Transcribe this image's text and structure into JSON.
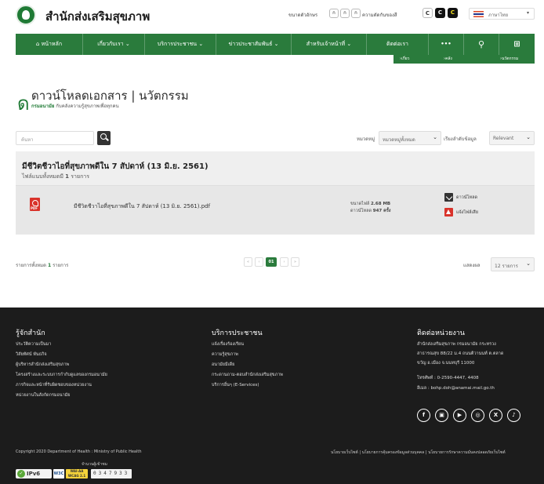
{
  "header": {
    "org_name": "สำนักส่งเสริมสุขภาพ",
    "font_size_label": "ขนาดตัวอักษร",
    "font_buttons": [
      "ก",
      "ก",
      "ก"
    ],
    "contrast_label": "ความตัดกันของสี",
    "contrast_buttons": [
      "C",
      "C",
      "C"
    ],
    "language": "ภาษาไทย"
  },
  "nav": {
    "home": "หน้าหลัก",
    "about": "เกี่ยวกับเรา",
    "services": "บริการประชาชน",
    "news": "ข่าวประชาสัมพันธ์",
    "staff": "สำหรับเจ้าหน้าที่",
    "contact": "ติดต่อเรา",
    "more": "•••"
  },
  "breadcrumb": [
    "เกี่ยวกับเรา",
    "คลังข้อมูลวิชาการ",
    "นวัตกรรม"
  ],
  "page": {
    "title_prefix": "ดาวน์โหลดเอกสาร",
    "title_section": "นวัตกรรม",
    "sub_brand": "กรมอนามัย",
    "sub_tagline": "กับคลังความรู้สุขภาพเพื่อทุกคน"
  },
  "filters": {
    "search_placeholder": "ค้นหา",
    "category_label": "หมวดหมู่",
    "category_value": "หมวดหมู่ทั้งหมด",
    "sort_label": "เรียงลำดับข้อมูล",
    "sort_value": "Relevant"
  },
  "document": {
    "title": "มีชีวิตชีวาไอที่สุขภาพดีใน 7 สัปดาห์ (13 มิ.ย. 2561)",
    "count_prefix": "ไฟล์แนบทั้งหมดมี",
    "count_value": "1",
    "count_suffix": "รายการ",
    "file_name": "มีชีวิตชีวาไอที่สุขภาพดีใน 7 สัปดาห์ (13 มิ.ย. 2561).pdf",
    "size_label": "ขนาดไฟล์",
    "size_value": "2.68 MB",
    "downloads_label": "ดาวน์โหลด",
    "downloads_value": "947 ครั้ง",
    "download_button": "ดาวน์โหลด",
    "report_button": "แจ้งไฟล์เสีย",
    "pdf_text": "PDF"
  },
  "pagination": {
    "total_prefix": "รายการทั้งหมด",
    "total_value": "1",
    "total_suffix": "รายการ",
    "first": "«",
    "prev": "‹",
    "current": "01",
    "next": "›",
    "last": "»",
    "show_label": "แสดงผล",
    "per_page": "12 รายการ"
  },
  "footer": {
    "about_heading": "รู้จักสำนัก",
    "about_links": [
      "ประวัติความเป็นมา",
      "วิสัยทัศน์ พันธกิจ",
      "ผู้บริหารสำนักส่งเสริมสุขภาพ",
      "โครงสร้างและระบบการกำกับดูแลของกรมอนามัย",
      "ภารกิจและหน้าที่รับผิดชอบของหน่วยงาน",
      "หน่วยงานในสังกัดกรมอนามัย"
    ],
    "services_heading": "บริการประชาชน",
    "services_links": [
      "แจ้งเรื่องร้องเรียน",
      "ความรู้สุขภาพ",
      "อนามัยมีเดีย",
      "กระดานถาม-ตอบสำนักส่งเสริมสุขภาพ",
      "บริการอื่นๆ (E-Services)"
    ],
    "contact_heading": "ติดต่อหน่วยงาน",
    "contact_lines": [
      "สำนักส่งเสริมสุขภาพ กรมอนามัย กระทรวง",
      "สาธารณสุข 88/22 ม.4 ถนนติวานนท์ ต.ตลาด",
      "ขวัญ อ.เมือง จ.นนทบุรี 11000",
      "โทรศัพท์ : 0-2590-4447, 4408",
      "อีเมล : bohp.doh@anamai.mail.go.th"
    ],
    "social": [
      "f",
      "▣",
      "▶",
      "◎",
      "X",
      "♪"
    ],
    "copyright": "Copyright 2020 Department of Health : Ministry of Public Health",
    "policy": "นโยบายเว็บไซต์ | นโยบายการคุ้มครองข้อมูลส่วนบุคคล | นโยบายการรักษาความมั่นคงปลอดภัยเว็บไซต์",
    "visits_label": "จำนวนผู้เข้าชม",
    "visits_count": "0347933",
    "ipv6": "IPv6",
    "w3c": "W3C",
    "wcag_line1": "WAI-AA",
    "wcag_line2": "WCAG 2.1"
  },
  "colors": {
    "brand_green": "#2a7b3c",
    "footer_bg": "#1c1c1c",
    "pdf_red": "#d9332b"
  }
}
